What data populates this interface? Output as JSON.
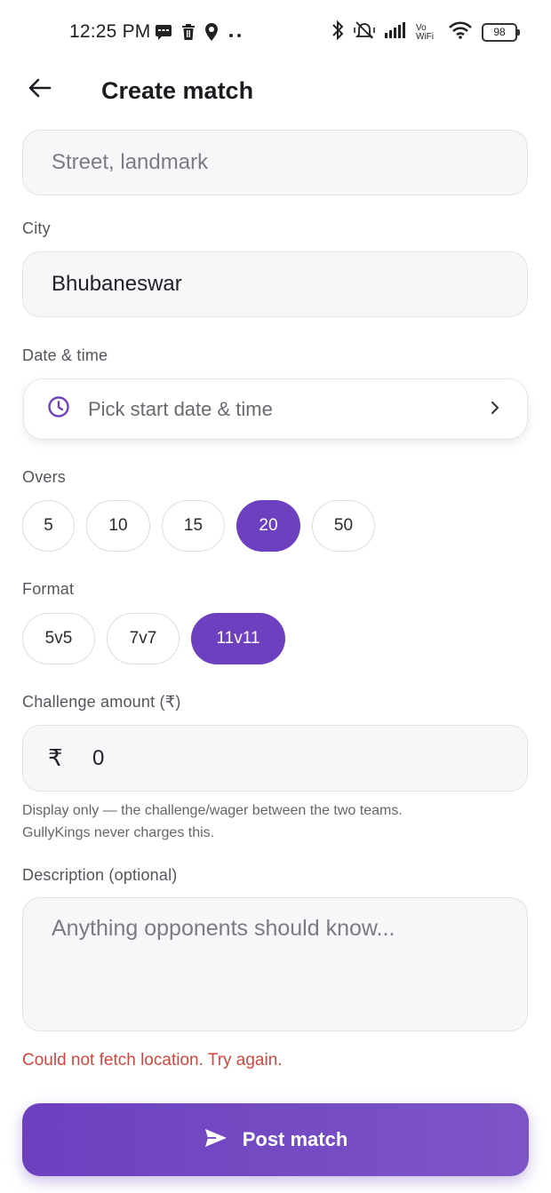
{
  "status_bar": {
    "time": "12:25 PM",
    "vowifi_top": "Vo",
    "vowifi_bottom": "WiFi",
    "battery": "98"
  },
  "header": {
    "title": "Create match"
  },
  "street_field": {
    "placeholder": "Street, landmark"
  },
  "city": {
    "label": "City",
    "value": "Bhubaneswar"
  },
  "datetime": {
    "label": "Date & time",
    "placeholder": "Pick start date & time"
  },
  "overs": {
    "label": "Overs",
    "options": [
      "5",
      "10",
      "15",
      "20",
      "50"
    ],
    "selected": "20"
  },
  "format": {
    "label": "Format",
    "options": [
      "5v5",
      "7v7",
      "11v11"
    ],
    "selected": "11v11"
  },
  "challenge": {
    "label": "Challenge amount (₹)",
    "currency_symbol": "₹",
    "value": "0",
    "helper_line1": "Display only — the challenge/wager between the two teams.",
    "helper_line2": "GullyKings never charges this."
  },
  "description": {
    "label": "Description (optional)",
    "placeholder": "Anything opponents should know..."
  },
  "error_message": "Could not fetch location. Try again.",
  "post_button": {
    "label": "Post match"
  },
  "colors": {
    "accent": "#6c40bf",
    "accent_light": "#7d55c7",
    "error": "#d2453d"
  }
}
